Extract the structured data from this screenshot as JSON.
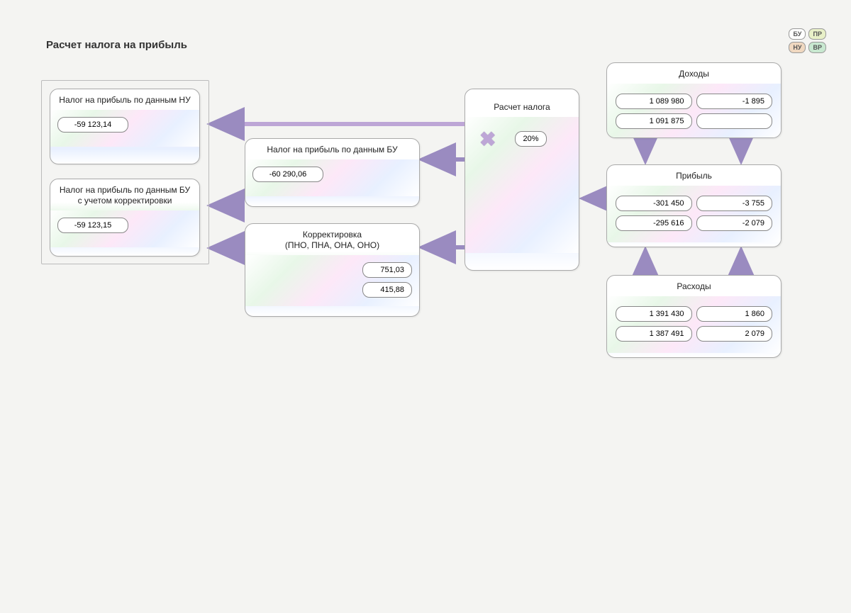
{
  "title": "Расчет налога на прибыль",
  "legend": {
    "bu": "БУ",
    "pr": "ПР",
    "nu": "НУ",
    "vr": "ВР"
  },
  "cards": {
    "nu_tax": {
      "title": "Налог на прибыль по данным НУ",
      "value": "-59 123,14"
    },
    "bu_tax_corrected": {
      "title": "Налог на прибыль по данным БУ\nс учетом корректировки",
      "value": "-59 123,15"
    },
    "bu_tax": {
      "title": "Налог на прибыль по данным БУ",
      "value": "-60 290,06"
    },
    "correction": {
      "title": "Корректировка\n(ПНО, ПНА, ОНА, ОНО)",
      "value1": "751,03",
      "value2": "415,88"
    },
    "calc": {
      "title": "Расчет налога",
      "rate": "20%"
    },
    "income": {
      "title": "Доходы",
      "bu": "1 089 980",
      "pr": "-1 895",
      "nu": "1 091 875",
      "vr": ""
    },
    "profit": {
      "title": "Прибыль",
      "bu": "-301 450",
      "pr": "-3 755",
      "nu": "-295 616",
      "vr": "-2 079"
    },
    "expenses": {
      "title": "Расходы",
      "bu": "1 391 430",
      "pr": "1 860",
      "nu": "1 387 491",
      "vr": "2 079"
    }
  }
}
